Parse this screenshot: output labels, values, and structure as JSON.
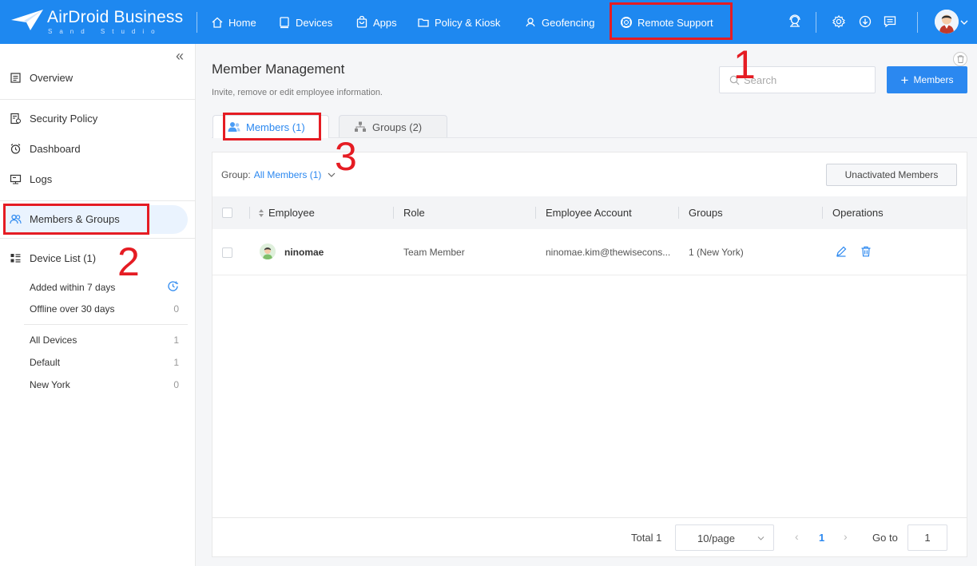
{
  "topbar": {
    "brand": "AirDroid Business",
    "brand_sub": "Sand Studio",
    "nav": [
      {
        "label": "Home",
        "icon": "home-icon"
      },
      {
        "label": "Devices",
        "icon": "device-icon"
      },
      {
        "label": "Apps",
        "icon": "apps-bag-icon"
      },
      {
        "label": "Policy & Kiosk",
        "icon": "folder-icon"
      },
      {
        "label": "Geofencing",
        "icon": "geofence-icon"
      },
      {
        "label": "Remote Support",
        "icon": "lifebuoy-icon"
      }
    ],
    "right_icons": [
      "support-agent-icon",
      "settings-icon",
      "download-icon",
      "message-icon",
      "avatar",
      "chevron-down-icon"
    ]
  },
  "sidebar": {
    "collapse_glyph": "«",
    "items": [
      {
        "label": "Overview",
        "icon": "overview-icon"
      },
      {
        "label": "Security Policy",
        "icon": "security-policy-icon"
      },
      {
        "label": "Dashboard",
        "icon": "dashboard-clock-icon"
      },
      {
        "label": "Logs",
        "icon": "logs-icon"
      },
      {
        "label": "Members & Groups",
        "icon": "members-icon"
      },
      {
        "label": "Device List (1)",
        "icon": "device-list-icon"
      }
    ],
    "device_filters": [
      {
        "label": "Added within 7 days",
        "count": ""
      },
      {
        "label": "Offline over 30 days",
        "count": "0"
      }
    ],
    "device_groups": [
      {
        "label": "All Devices",
        "count": "1"
      },
      {
        "label": "Default",
        "count": "1"
      },
      {
        "label": "New York",
        "count": "0"
      }
    ]
  },
  "annotations": [
    "1",
    "2",
    "3"
  ],
  "main": {
    "title": "Member Management",
    "subtitle": "Invite, remove or edit employee information.",
    "search_placeholder": "Search",
    "add_button": "Members",
    "add_button_glyph": "+",
    "tabs": [
      {
        "label": "Members (1)",
        "active": true
      },
      {
        "label": "Groups (2)",
        "active": false
      }
    ],
    "group_label": "Group:",
    "group_value": "All Members (1)",
    "unactivated_button": "Unactivated Members",
    "table": {
      "columns": [
        "Employee",
        "Role",
        "Employee Account",
        "Groups",
        "Operations"
      ],
      "rows": [
        {
          "employee": "ninomae",
          "role": "Team Member",
          "account": "ninomae.kim@thewisecons...",
          "groups": "1 (New York)"
        }
      ]
    },
    "pagination": {
      "total_label": "Total 1",
      "page_size": "10/page",
      "prev": "‹",
      "current_page": "1",
      "next": "›",
      "goto_label": "Go to",
      "goto_value": "1"
    }
  },
  "colors": {
    "topbar": "#1e88f0",
    "accent": "#2b88f0",
    "annotation": "#e51c23"
  }
}
